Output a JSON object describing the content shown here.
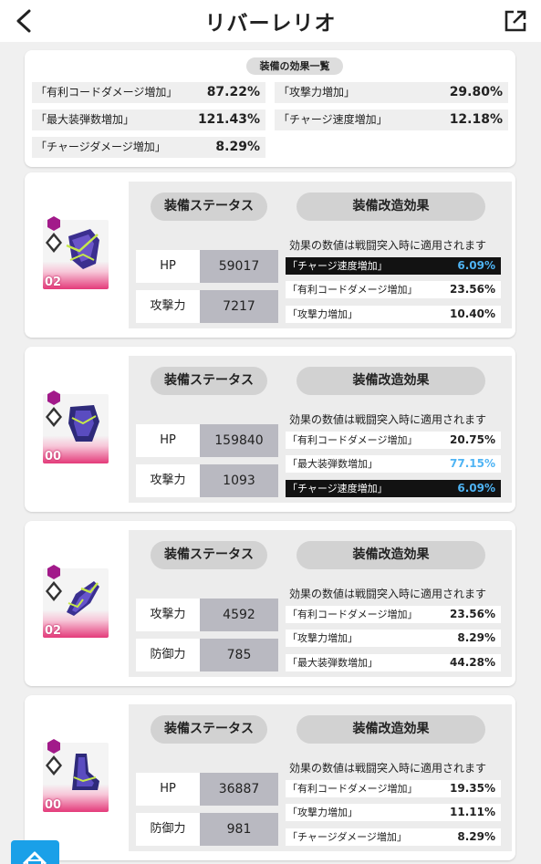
{
  "header": {
    "title": "リバーレリオ"
  },
  "summary": {
    "title": "装備の効果一覧",
    "rows": [
      {
        "label": "「有利コードダメージ増加」",
        "value": "87.22%"
      },
      {
        "label": "「攻撃力増加」",
        "value": "29.80%"
      },
      {
        "label": "「最大装弾数増加」",
        "value": "121.43%"
      },
      {
        "label": "「チャージ速度増加」",
        "value": "12.18%"
      },
      {
        "label": "「チャージダメージ増加」",
        "value": "8.29%"
      }
    ]
  },
  "cards": [
    {
      "level": "02",
      "status_label": "装備ステータス",
      "mod_label": "装備改造効果",
      "note": "効果の数値は戦闘突入時に適用されます",
      "stats": [
        {
          "label": "HP",
          "value": "59017"
        },
        {
          "label": "攻撃力",
          "value": "7217"
        }
      ],
      "effects": [
        {
          "label": "「チャージ速度増加」",
          "value": "6.09%"
        },
        {
          "label": "「有利コードダメージ増加」",
          "value": "23.56%"
        },
        {
          "label": "「攻撃力増加」",
          "value": "10.40%"
        }
      ]
    },
    {
      "level": "00",
      "status_label": "装備ステータス",
      "mod_label": "装備改造効果",
      "note": "効果の数値は戦闘突入時に適用されます",
      "stats": [
        {
          "label": "HP",
          "value": "159840"
        },
        {
          "label": "攻撃力",
          "value": "1093"
        }
      ],
      "effects": [
        {
          "label": "「有利コードダメージ増加」",
          "value": "20.75%"
        },
        {
          "label": "「最大装弾数増加」",
          "value": "77.15%"
        },
        {
          "label": "「チャージ速度増加」",
          "value": "6.09%"
        }
      ]
    },
    {
      "level": "02",
      "status_label": "装備ステータス",
      "mod_label": "装備改造効果",
      "note": "効果の数値は戦闘突入時に適用されます",
      "stats": [
        {
          "label": "攻撃力",
          "value": "4592"
        },
        {
          "label": "防御力",
          "value": "785"
        }
      ],
      "effects": [
        {
          "label": "「有利コードダメージ増加」",
          "value": "23.56%"
        },
        {
          "label": "「攻撃力増加」",
          "value": "8.29%"
        },
        {
          "label": "「最大装弾数増加」",
          "value": "44.28%"
        }
      ]
    },
    {
      "level": "00",
      "status_label": "装備ステータス",
      "mod_label": "装備改造効果",
      "note": "効果の数値は戦闘突入時に適用されます",
      "stats": [
        {
          "label": "HP",
          "value": "36887"
        },
        {
          "label": "防御力",
          "value": "981"
        }
      ],
      "effects": [
        {
          "label": "「有利コードダメージ増加」",
          "value": "19.35%"
        },
        {
          "label": "「攻撃力増加」",
          "value": "11.11%"
        },
        {
          "label": "「チャージダメージ増加」",
          "value": "8.29%"
        }
      ]
    }
  ]
}
